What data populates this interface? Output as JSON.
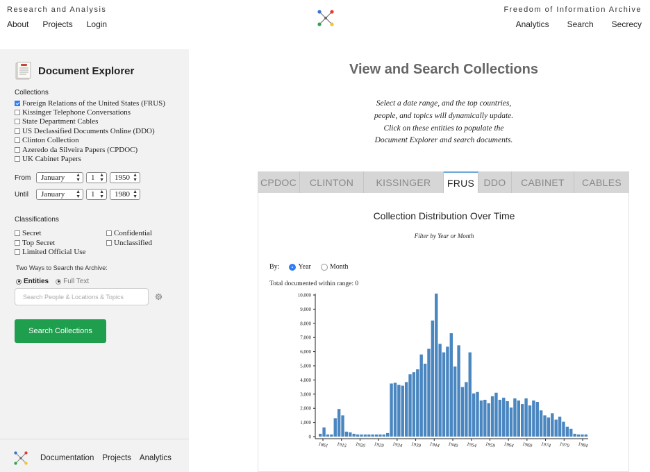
{
  "header": {
    "left_title": "Research and Analysis",
    "left_nav": [
      "About",
      "Projects",
      "Login"
    ],
    "right_title": "Freedom of Information Archive",
    "right_nav": [
      "Analytics",
      "Search",
      "Secrecy"
    ]
  },
  "sidebar": {
    "title": "Document Explorer",
    "collections_label": "Collections",
    "collections": [
      {
        "label": "Foreign Relations of the United States (FRUS)",
        "checked": true
      },
      {
        "label": "Kissinger Telephone Conversations",
        "checked": false
      },
      {
        "label": "State Department Cables",
        "checked": false
      },
      {
        "label": "US Declassified Documents Online (DDO)",
        "checked": false
      },
      {
        "label": "Clinton Collection",
        "checked": false
      },
      {
        "label": "Azeredo da Silveira Papers (CPDOC)",
        "checked": false
      },
      {
        "label": "UK Cabinet Papers",
        "checked": false
      }
    ],
    "from_label": "From",
    "until_label": "Until",
    "from": {
      "month": "January",
      "day": "1",
      "year": "1950"
    },
    "until": {
      "month": "January",
      "day": "1",
      "year": "1980"
    },
    "classifications_label": "Classifications",
    "classifications": [
      "Secret",
      "Confidential",
      "Top Secret",
      "Unclassified",
      "Limited Official Use"
    ],
    "two_ways": "Two Ways to Search the Archive:",
    "mode_entities": "Entities",
    "mode_fulltext": "Full Text",
    "search_placeholder": "Search People & Locations & Topics",
    "search_button": "Search Collections",
    "footer_nav": [
      "Documentation",
      "Projects",
      "Analytics"
    ]
  },
  "main": {
    "title": "View and Search Collections",
    "intro_lines": [
      "Select a date range, and the top countries,",
      "people, and topics will dynamically update.",
      "Click on these entities to populate the",
      "Document Explorer and search documents."
    ],
    "tabs": [
      {
        "label": "CPDOC",
        "active": false
      },
      {
        "label": "CLINTON",
        "active": false
      },
      {
        "label": "KISSINGER",
        "active": false
      },
      {
        "label": "FRUS",
        "active": true
      },
      {
        "label": "DDO",
        "active": false
      },
      {
        "label": "CABINET",
        "active": false
      },
      {
        "label": "CABLES",
        "active": false
      }
    ],
    "by_label": "By:",
    "by_year": "Year",
    "by_month": "Month",
    "total_text": "Total documented within range: 0"
  },
  "colors": {
    "accent": "#2e7cf6",
    "button": "#1f9e4e",
    "bar": "#4a86c0",
    "sidebar_bg": "#f2f2f2"
  },
  "chart_data": {
    "type": "bar",
    "title": "Collection Distribution Over Time",
    "subtitle": "Filter by Year or Month",
    "x_start": 1861,
    "x_tick_labels": [
      "1861",
      "1915",
      "1920",
      "1929",
      "1934",
      "1939",
      "1944",
      "1949",
      "1954",
      "1959",
      "1964",
      "1969",
      "1974",
      "1979",
      "1984"
    ],
    "y_tick_labels": [
      "0",
      "1,000",
      "2,000",
      "3,000",
      "4,000",
      "5,000",
      "6,000",
      "7,000",
      "8,000",
      "9,000",
      "10,000"
    ],
    "ylim": [
      0,
      10000
    ],
    "values": [
      200,
      650,
      150,
      150,
      1300,
      1950,
      1500,
      350,
      300,
      200,
      150,
      150,
      150,
      150,
      150,
      150,
      150,
      150,
      250,
      3750,
      3800,
      3650,
      3600,
      3850,
      4400,
      4550,
      4750,
      5800,
      5150,
      6200,
      8200,
      10100,
      6550,
      5950,
      6350,
      7300,
      4950,
      6450,
      3500,
      3850,
      5950,
      3050,
      3150,
      2550,
      2600,
      2350,
      2850,
      3100,
      2600,
      2750,
      2500,
      2050,
      2700,
      2550,
      2300,
      2700,
      2200,
      2550,
      2450,
      1850,
      1500,
      1350,
      1650,
      1200,
      1400,
      1050,
      700,
      550,
      200,
      150,
      150,
      150
    ]
  }
}
